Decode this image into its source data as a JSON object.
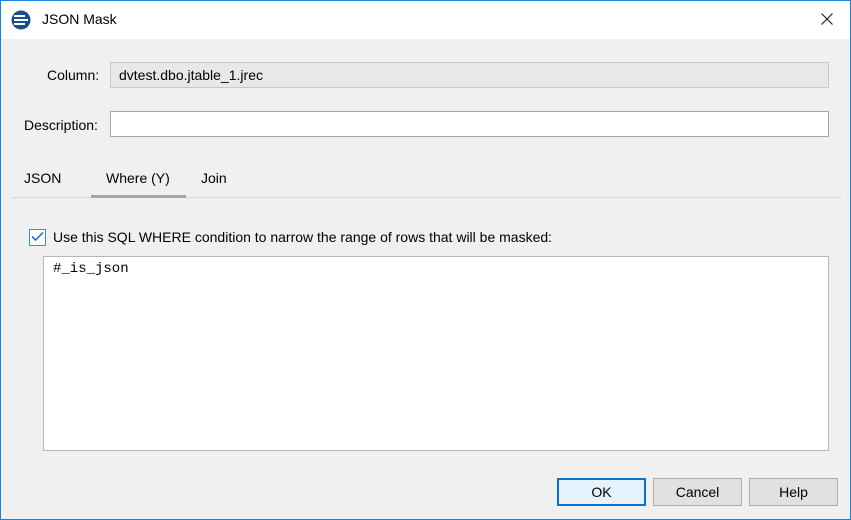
{
  "window": {
    "title": "JSON Mask"
  },
  "form": {
    "column_label": "Column:",
    "column_value": "dvtest.dbo.jtable_1.jrec",
    "description_label": "Description:",
    "description_value": ""
  },
  "tabs": [
    {
      "label": "JSON",
      "selected": false
    },
    {
      "label": "Where (Y)",
      "selected": true
    },
    {
      "label": "Join",
      "selected": false
    }
  ],
  "where": {
    "checkbox_checked": true,
    "checkbox_label": "Use this SQL WHERE condition to narrow the range of rows that will be masked:",
    "sql": "#_is_json"
  },
  "buttons": {
    "ok": "OK",
    "cancel": "Cancel",
    "help": "Help"
  },
  "colors": {
    "accent": "#0a72c9",
    "window_border": "#1883d7"
  },
  "icons": {
    "app": "app-database-icon",
    "close": "close-icon",
    "check": "checkmark-icon"
  }
}
